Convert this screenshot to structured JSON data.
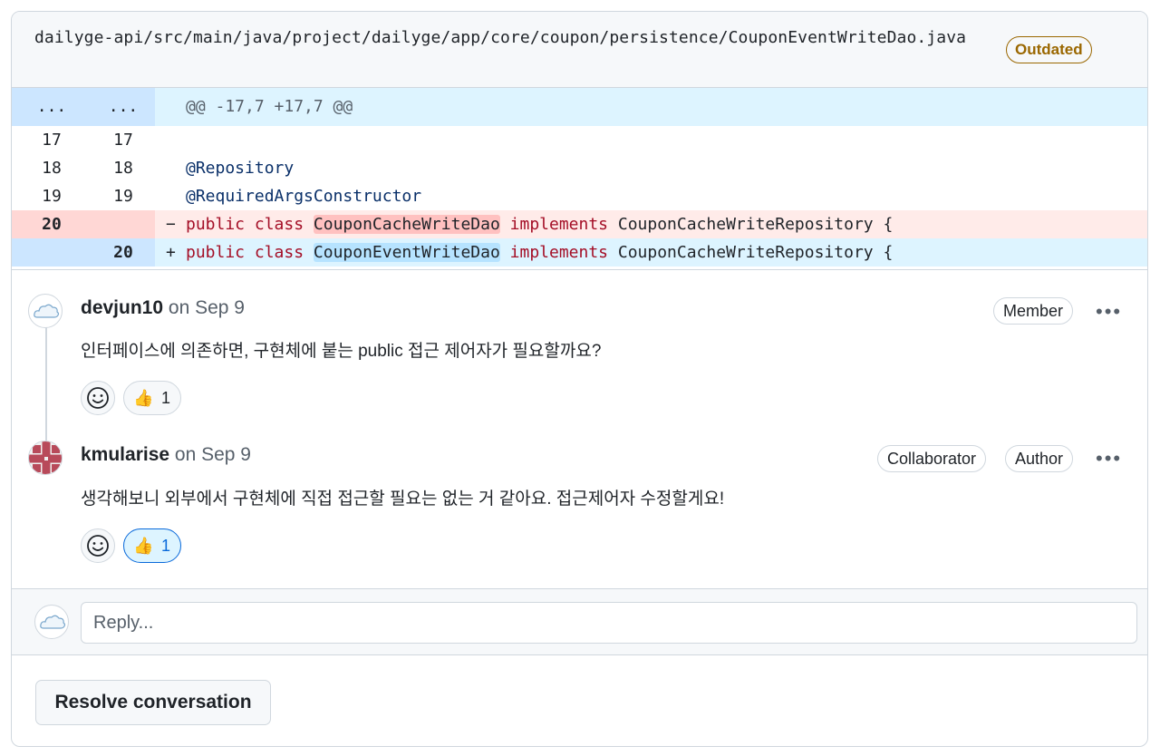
{
  "file": {
    "path": "dailyge-api/src/main/java/project/dailyge/app/core/coupon/persistence/CouponEventWriteDao.java",
    "status_badge": "Outdated"
  },
  "diff": {
    "hunk": {
      "old": "...",
      "new": "...",
      "text": "@@ -17,7 +17,7 @@"
    },
    "lines": [
      {
        "old": "17",
        "new": "17",
        "type": "context",
        "text": ""
      },
      {
        "old": "18",
        "new": "18",
        "type": "context",
        "text": "@Repository"
      },
      {
        "old": "19",
        "new": "19",
        "type": "context",
        "text": "@RequiredArgsConstructor"
      },
      {
        "old": "20",
        "new": "",
        "type": "del",
        "marker": "−",
        "kw1": "public class",
        "name": "CouponCacheWriteDao",
        "kw2": "implements",
        "rest": "CouponCacheWriteRepository {"
      },
      {
        "old": "",
        "new": "20",
        "type": "add",
        "marker": "+",
        "kw1": "public class",
        "name": "CouponEventWriteDao",
        "kw2": "implements",
        "rest": "CouponCacheWriteRepository {"
      }
    ]
  },
  "comments": [
    {
      "author": "devjun10",
      "date": "on Sep 9",
      "badges": [
        "Member"
      ],
      "body": "인터페이스에 의존하면, 구현체에 붙는 public 접근 제어자가 필요할까요?",
      "reaction": {
        "emoji": "👍",
        "count": "1",
        "active": false
      },
      "avatar_icon": "cloud-avatar-icon"
    },
    {
      "author": "kmularise",
      "date": "on Sep 9",
      "badges": [
        "Collaborator",
        "Author"
      ],
      "body": "생각해보니 외부에서 구현체에 직접 접근할 필요는 없는 거 같아요. 접근제어자 수정할게요!",
      "reaction": {
        "emoji": "👍",
        "count": "1",
        "active": true
      },
      "avatar_icon": "identicon-avatar-icon"
    }
  ],
  "reply": {
    "placeholder": "Reply..."
  },
  "actions": {
    "resolve_label": "Resolve conversation"
  },
  "colors": {
    "accent": "#0969da",
    "outdated": "#9a6700",
    "deletion_bg": "#ffebe9",
    "addition_bg": "#ddf4ff"
  }
}
